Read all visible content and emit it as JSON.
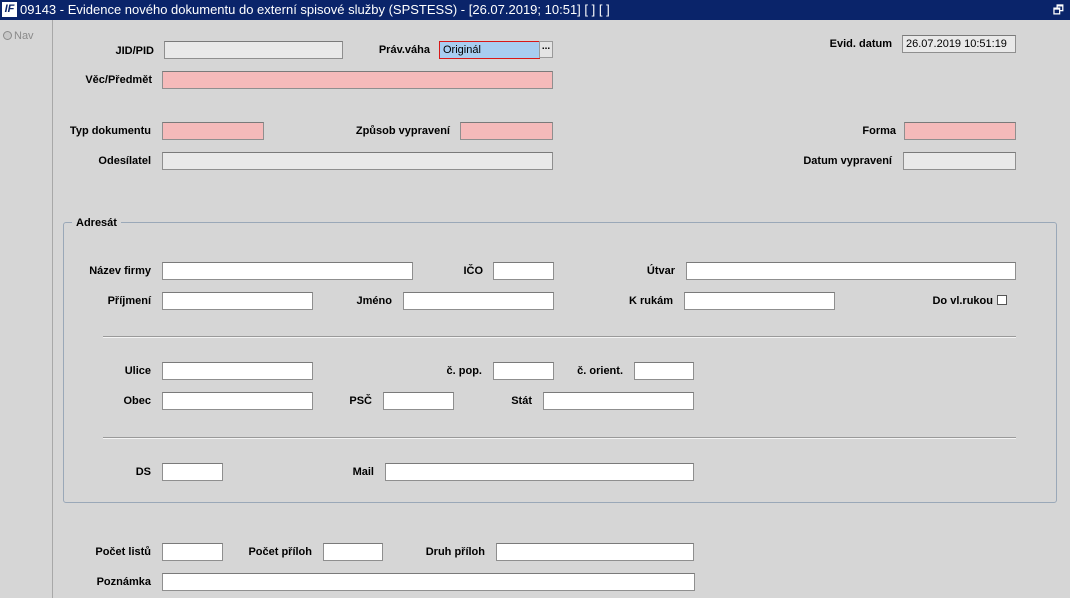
{
  "titlebar": {
    "app_icon": "IF",
    "title": "09143 - Evidence nového dokumentu do externí spisové služby (SPSTESS) - [26.07.2019; 10:51]  [ ]  [ ]",
    "restore_icon": "restore-icon"
  },
  "nav": {
    "label": "Nav"
  },
  "header": {
    "jid_label": "JID/PID",
    "jid_value": "",
    "prav_vaha_label": "Práv.váha",
    "prav_vaha_value": "Originál",
    "prav_vaha_btn": "...",
    "evid_datum_label": "Evid. datum",
    "evid_datum_value": "26.07.2019 10:51:19",
    "vec_label": "Věc/Předmět",
    "vec_value": "",
    "typ_label": "Typ dokumentu",
    "typ_value": "",
    "zpusob_label": "Způsob vypravení",
    "zpusob_value": "",
    "forma_label": "Forma",
    "forma_value": "",
    "odesilatel_label": "Odesílatel",
    "odesilatel_value": "",
    "datum_vyp_label": "Datum vypravení",
    "datum_vyp_value": ""
  },
  "adresat": {
    "legend": "Adresát",
    "nazev_firmy_label": "Název firmy",
    "ico_label": "IČO",
    "utvar_label": "Útvar",
    "prijmeni_label": "Příjmení",
    "jmeno_label": "Jméno",
    "k_rukam_label": "K rukám",
    "do_vl_rukou_label": "Do vl.rukou",
    "ulice_label": "Ulice",
    "c_pop_label": "č. pop.",
    "c_orient_label": "č. orient.",
    "obec_label": "Obec",
    "psc_label": "PSČ",
    "stat_label": "Stát",
    "ds_label": "DS",
    "mail_label": "Mail"
  },
  "footer": {
    "pocet_listu_label": "Počet listů",
    "pocet_priloh_label": "Počet příloh",
    "druh_priloh_label": "Druh příloh",
    "poznamka_label": "Poznámka"
  },
  "colors": {
    "titlebar": "#0a246a",
    "required": "#f5baba",
    "readonly": "#e9e9e9",
    "selected": "#a8cdf0"
  }
}
